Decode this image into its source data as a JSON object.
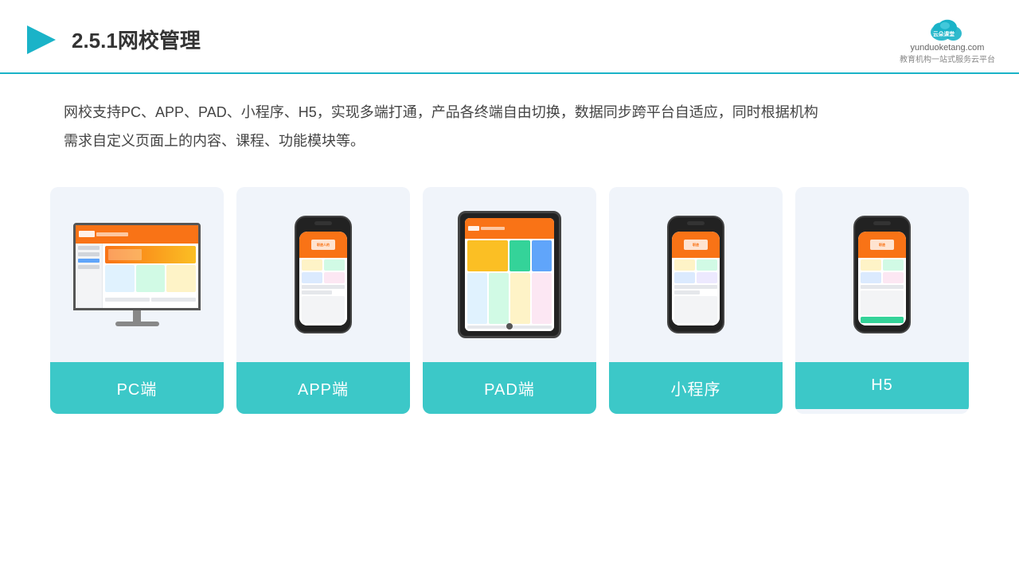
{
  "header": {
    "title": "2.5.1网校管理",
    "logo_name": "云朵课堂",
    "logo_url": "yunduoketang.com",
    "logo_sub": "教育机构一站式服务云平台"
  },
  "description": "网校支持PC、APP、PAD、小程序、H5，实现多端打通，产品各终端自由切换，数据同步跨平台自适应，同时根据机构需求自定义页面上的内容、课程、功能模块等。",
  "cards": [
    {
      "id": "pc",
      "label": "PC端",
      "type": "monitor"
    },
    {
      "id": "app",
      "label": "APP端",
      "type": "phone"
    },
    {
      "id": "pad",
      "label": "PAD端",
      "type": "tablet"
    },
    {
      "id": "miniprogram",
      "label": "小程序",
      "type": "phone"
    },
    {
      "id": "h5",
      "label": "H5",
      "type": "phone"
    }
  ]
}
